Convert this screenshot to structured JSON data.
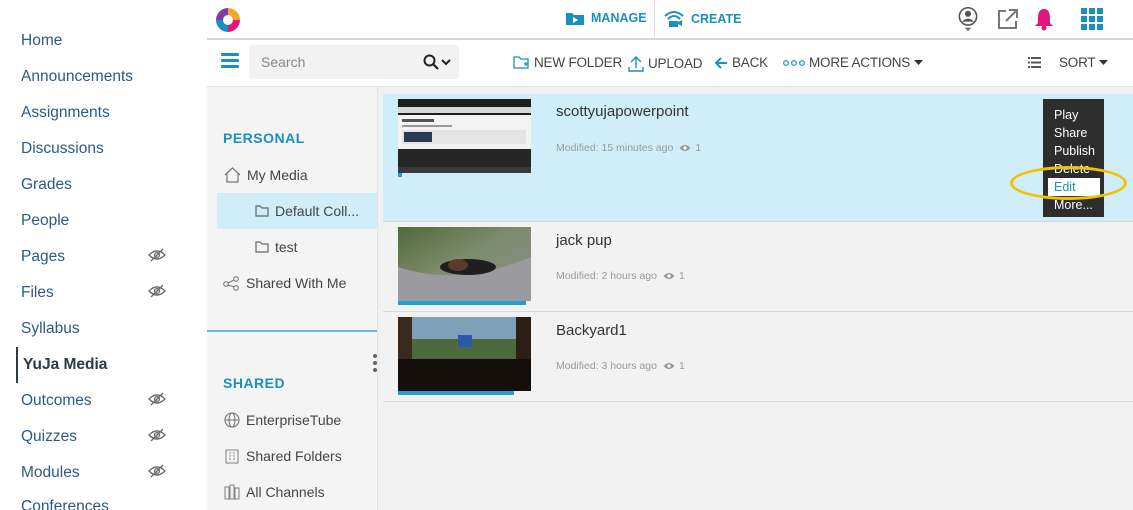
{
  "course_nav": {
    "items": [
      {
        "label": "Home",
        "hidden": false
      },
      {
        "label": "Announcements",
        "hidden": false
      },
      {
        "label": "Assignments",
        "hidden": false
      },
      {
        "label": "Discussions",
        "hidden": false
      },
      {
        "label": "Grades",
        "hidden": false
      },
      {
        "label": "People",
        "hidden": false
      },
      {
        "label": "Pages",
        "hidden": true
      },
      {
        "label": "Files",
        "hidden": true
      },
      {
        "label": "Syllabus",
        "hidden": false
      },
      {
        "label": "YuJa Media",
        "hidden": false,
        "active": true
      },
      {
        "label": "Outcomes",
        "hidden": true
      },
      {
        "label": "Quizzes",
        "hidden": true
      },
      {
        "label": "Modules",
        "hidden": true
      },
      {
        "label": "Conferences",
        "hidden": false
      }
    ]
  },
  "topbar": {
    "manage_label": "MANAGE",
    "create_label": "CREATE",
    "icons": [
      "user-profile-icon",
      "external-link-icon",
      "notification-bell-icon",
      "apps-grid-icon"
    ]
  },
  "toolbar": {
    "search_placeholder": "Search",
    "new_folder_label": "NEW FOLDER",
    "upload_label": "UPLOAD",
    "back_label": "BACK",
    "more_actions_label": "MORE ACTIONS",
    "sort_label": "SORT"
  },
  "library": {
    "personal_title": "PERSONAL",
    "my_media_label": "My Media",
    "default_collection_label": "Default Coll...",
    "test_label": "test",
    "shared_with_me_label": "Shared With Me",
    "shared_title": "SHARED",
    "enterprise_tube_label": "EnterpriseTube",
    "shared_folders_label": "Shared Folders",
    "all_channels_label": "All Channels"
  },
  "media": [
    {
      "title": "scottyujapowerpoint",
      "modified": "Modified: 15 minutes ago",
      "views": "1"
    },
    {
      "title": "jack pup",
      "modified": "Modified: 2 hours ago",
      "views": "1"
    },
    {
      "title": "Backyard1",
      "modified": "Modified: 3 hours ago",
      "views": "1"
    }
  ],
  "context_menu": {
    "play": "Play",
    "share": "Share",
    "publish": "Publish",
    "delete": "Delete",
    "edit": "Edit",
    "more": "More..."
  },
  "colors": {
    "accent": "#1a8fc1",
    "selection": "#cfeefa",
    "bell": "#e0177d",
    "highlight_ring": "#f2c200"
  }
}
